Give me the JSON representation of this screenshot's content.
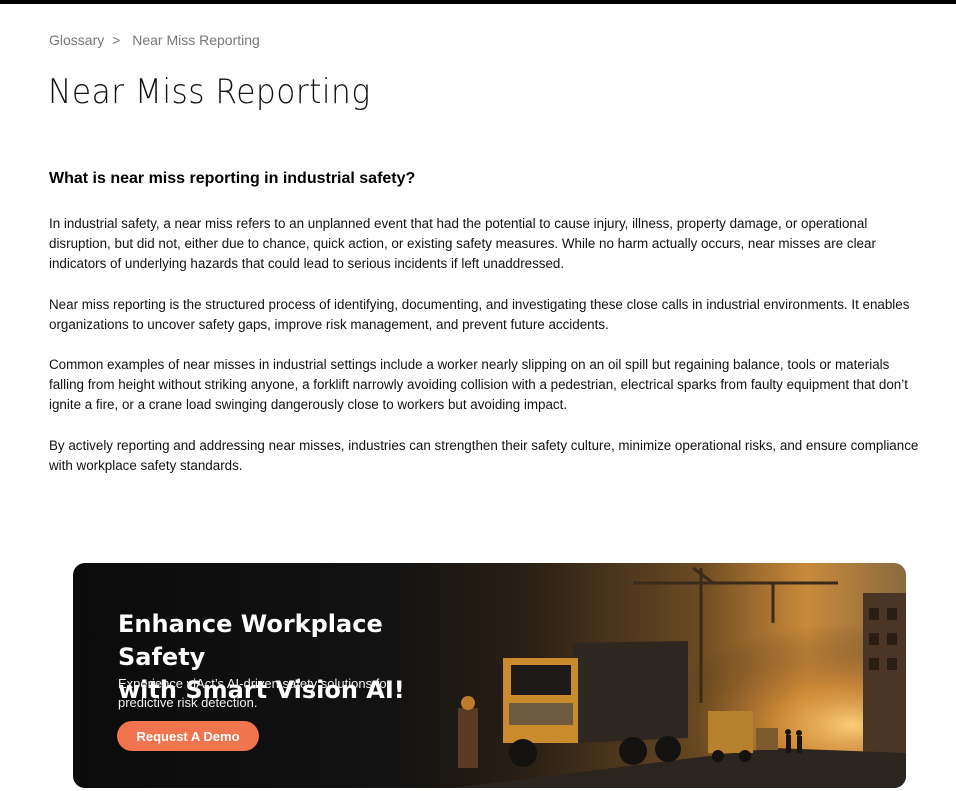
{
  "breadcrumb": {
    "items": [
      "Glossary",
      "Near Miss Reporting"
    ],
    "separator": ">"
  },
  "page": {
    "title": "Near Miss Reporting",
    "section_heading": "What is near miss reporting in industrial safety?",
    "paragraphs": [
      "In industrial safety, a near miss refers to an unplanned event that had the potential to cause injury, illness, property damage, or operational disruption, but did not, either due to chance, quick action, or existing safety measures. While no harm actually occurs, near misses are clear indicators of underlying hazards that could lead to serious incidents if left unaddressed.",
      "Near miss reporting is the structured process of identifying, documenting, and investigating these close calls in industrial environments. It enables organizations to uncover safety gaps, improve risk management, and prevent future accidents.",
      "Common examples of near misses in industrial settings include a worker nearly slipping on an oil spill but regaining balance, tools or materials falling from height without striking anyone, a forklift narrowly avoiding collision with a pedestrian, electrical sparks from faulty equipment that don’t ignite a fire, or a crane load swinging dangerously close to workers but avoiding impact.",
      "By actively reporting and addressing near misses, industries can strengthen their safety culture, minimize operational risks, and ensure compliance with workplace safety standards."
    ]
  },
  "banner": {
    "title_line1": "Enhance Workplace Safety",
    "title_line2": "with Smart Vision AI!",
    "subtitle": "Experience viAct’s AI-driven safety solutions for predictive risk detection.",
    "cta_label": "Request A Demo",
    "accent_color": "#f0744d"
  }
}
